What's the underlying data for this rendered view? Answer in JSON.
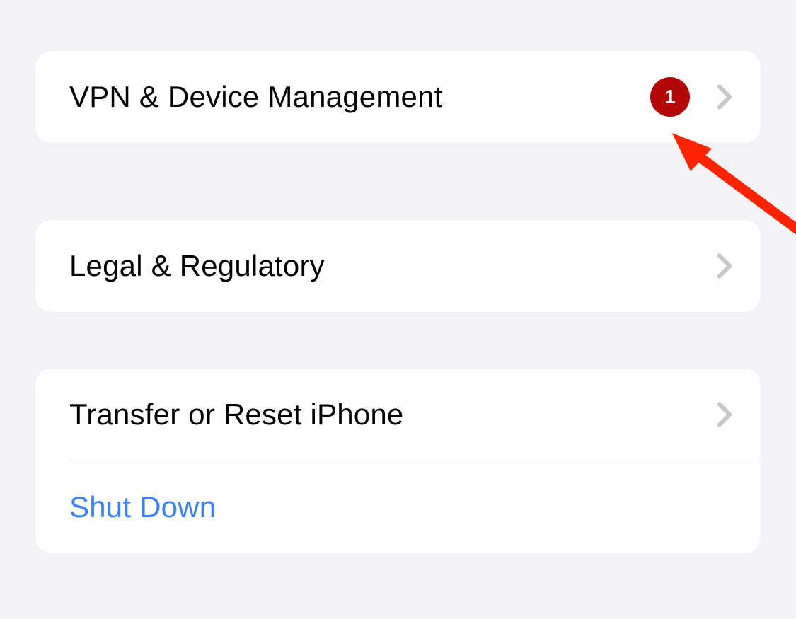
{
  "colors": {
    "background": "#f2f2f7",
    "card": "#ffffff",
    "text": "#000000",
    "link": "#3b82f6",
    "chevron": "#c7c7cc",
    "badge_bg": "#b40606",
    "badge_text": "#ffffff",
    "divider": "#e5e5ea",
    "annotation": "#fe2400"
  },
  "groups": [
    {
      "rows": [
        {
          "label": "VPN & Device Management",
          "badge": "1",
          "chevron": true
        }
      ]
    },
    {
      "rows": [
        {
          "label": "Legal & Regulatory",
          "chevron": true
        }
      ]
    },
    {
      "rows": [
        {
          "label": "Transfer or Reset iPhone",
          "chevron": true
        },
        {
          "label": "Shut Down",
          "is_link": true
        }
      ]
    }
  ]
}
